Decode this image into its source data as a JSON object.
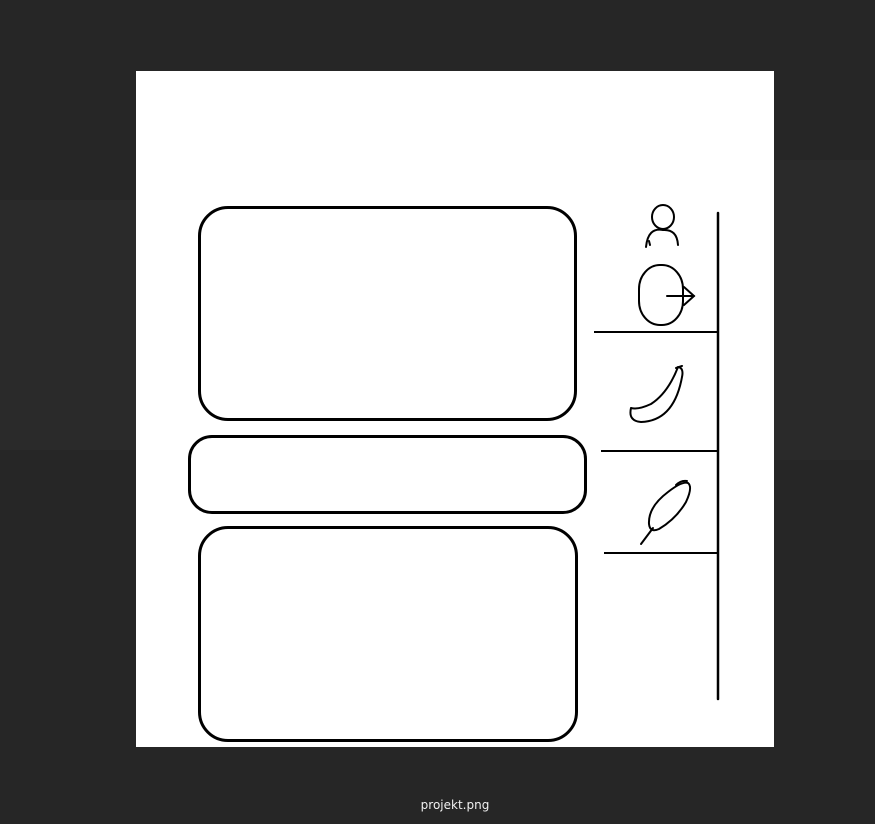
{
  "viewer": {
    "filename": "projekt.png"
  },
  "sketch": {
    "sidebar_icons": [
      "user-icon",
      "login-icon",
      "banana-icon",
      "feather-icon"
    ],
    "stroke_color": "#000000",
    "canvas_color": "#ffffff",
    "background_color": "#262626"
  }
}
